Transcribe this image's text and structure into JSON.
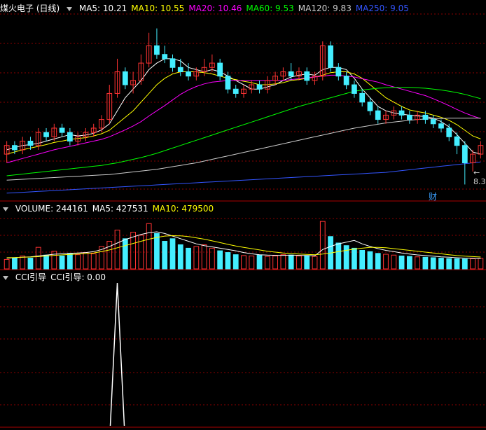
{
  "title": "煤火电子 (日线)",
  "price_legend": [
    {
      "label": "MA5: 10.21",
      "color": "#ffffff"
    },
    {
      "label": "MA10: 10.55",
      "color": "#ffff00"
    },
    {
      "label": "MA20: 10.46",
      "color": "#ff00ff"
    },
    {
      "label": "MA60: 9.53",
      "color": "#00ff00"
    },
    {
      "label": "MA120: 9.83",
      "color": "#cccccc"
    },
    {
      "label": "MA250: 9.05",
      "color": "#3355ff"
    }
  ],
  "low_price_label": "8.30",
  "finance_marker": "财",
  "volume_legend": [
    {
      "label": "VOLUME: 244161",
      "color": "#ffffff"
    },
    {
      "label": "MA5: 427531",
      "color": "#ffffff"
    },
    {
      "label": "MA10: 479500",
      "color": "#ffff00"
    }
  ],
  "cci_legend": [
    {
      "label": "CCI引导",
      "color": "#ffffff"
    },
    {
      "label": "CCI引导: 0.00",
      "color": "#ffffff"
    }
  ],
  "colors": {
    "up": "#ff3333",
    "down": "#44eeff",
    "grid": "#8b0000",
    "bg": "#000000"
  },
  "chart_data": [
    {
      "type": "candlestick",
      "title": "煤火电子 (日线)",
      "ylim": [
        8.0,
        12.2
      ],
      "candles": [
        [
          9.0,
          9.2,
          8.8,
          9.3
        ],
        [
          9.2,
          9.1,
          9.0,
          9.3
        ],
        [
          9.1,
          9.3,
          9.0,
          9.4
        ],
        [
          9.3,
          9.2,
          9.1,
          9.4
        ],
        [
          9.2,
          9.5,
          9.1,
          9.6
        ],
        [
          9.5,
          9.4,
          9.3,
          9.6
        ],
        [
          9.4,
          9.6,
          9.3,
          9.7
        ],
        [
          9.6,
          9.5,
          9.4,
          9.7
        ],
        [
          9.5,
          9.3,
          9.2,
          9.6
        ],
        [
          9.3,
          9.4,
          9.2,
          9.5
        ],
        [
          9.4,
          9.5,
          9.3,
          9.6
        ],
        [
          9.5,
          9.6,
          9.4,
          9.7
        ],
        [
          9.6,
          9.8,
          9.5,
          9.9
        ],
        [
          9.8,
          10.4,
          9.7,
          10.6
        ],
        [
          10.4,
          10.9,
          10.3,
          11.2
        ],
        [
          10.9,
          10.6,
          10.5,
          11.0
        ],
        [
          10.6,
          10.7,
          10.4,
          10.9
        ],
        [
          10.7,
          11.1,
          10.6,
          11.3
        ],
        [
          11.1,
          11.5,
          11.0,
          11.8
        ],
        [
          11.5,
          11.3,
          11.2,
          11.9
        ],
        [
          11.3,
          11.2,
          11.1,
          11.5
        ],
        [
          11.2,
          11.0,
          10.9,
          11.3
        ],
        [
          11.0,
          10.9,
          10.8,
          11.2
        ],
        [
          10.9,
          10.8,
          10.7,
          11.1
        ],
        [
          10.8,
          10.9,
          10.7,
          11.0
        ],
        [
          10.9,
          11.0,
          10.8,
          11.2
        ],
        [
          11.0,
          11.1,
          10.9,
          11.3
        ],
        [
          11.1,
          10.8,
          10.7,
          11.2
        ],
        [
          10.8,
          10.5,
          10.4,
          10.9
        ],
        [
          10.5,
          10.4,
          10.3,
          10.6
        ],
        [
          10.4,
          10.5,
          10.3,
          10.6
        ],
        [
          10.5,
          10.6,
          10.4,
          10.7
        ],
        [
          10.6,
          10.5,
          10.4,
          10.7
        ],
        [
          10.5,
          10.7,
          10.4,
          10.8
        ],
        [
          10.7,
          10.8,
          10.6,
          10.9
        ],
        [
          10.8,
          10.9,
          10.7,
          11.0
        ],
        [
          10.9,
          10.8,
          10.7,
          11.1
        ],
        [
          10.8,
          10.9,
          10.7,
          11.0
        ],
        [
          10.9,
          10.7,
          10.6,
          11.0
        ],
        [
          10.7,
          10.8,
          10.6,
          10.9
        ],
        [
          10.8,
          11.5,
          10.7,
          11.6
        ],
        [
          11.5,
          11.0,
          10.9,
          11.6
        ],
        [
          11.0,
          10.8,
          10.7,
          11.1
        ],
        [
          10.8,
          10.6,
          10.5,
          10.9
        ],
        [
          10.6,
          10.4,
          10.3,
          10.7
        ],
        [
          10.4,
          10.2,
          10.1,
          10.5
        ],
        [
          10.2,
          10.0,
          9.9,
          10.3
        ],
        [
          10.0,
          9.8,
          9.7,
          10.1
        ],
        [
          9.8,
          9.9,
          9.7,
          10.0
        ],
        [
          9.9,
          10.0,
          9.8,
          10.1
        ],
        [
          10.0,
          9.9,
          9.8,
          10.1
        ],
        [
          9.9,
          9.8,
          9.7,
          10.0
        ],
        [
          9.8,
          9.9,
          9.7,
          10.0
        ],
        [
          9.9,
          9.8,
          9.7,
          10.0
        ],
        [
          9.8,
          9.7,
          9.6,
          9.9
        ],
        [
          9.7,
          9.6,
          9.5,
          9.8
        ],
        [
          9.6,
          9.4,
          9.3,
          9.7
        ],
        [
          9.4,
          9.2,
          9.0,
          9.5
        ],
        [
          9.2,
          8.8,
          8.3,
          9.3
        ],
        [
          8.8,
          9.0,
          8.6,
          9.1
        ],
        [
          9.0,
          9.2,
          8.9,
          9.3
        ]
      ],
      "series_ma": [
        {
          "name": "MA5",
          "color": "#ffffff",
          "values": [
            9.1,
            9.15,
            9.2,
            9.22,
            9.25,
            9.3,
            9.35,
            9.4,
            9.45,
            9.42,
            9.44,
            9.48,
            9.56,
            9.7,
            10.0,
            10.3,
            10.5,
            10.7,
            10.95,
            11.1,
            11.2,
            11.2,
            11.15,
            11.0,
            10.95,
            10.9,
            10.95,
            10.9,
            10.8,
            10.7,
            10.6,
            10.5,
            10.5,
            10.55,
            10.6,
            10.7,
            10.78,
            10.82,
            10.85,
            10.82,
            10.95,
            11.0,
            11.0,
            10.95,
            10.75,
            10.5,
            10.3,
            10.1,
            10.0,
            9.95,
            9.92,
            9.9,
            9.88,
            9.87,
            9.83,
            9.75,
            9.63,
            9.45,
            9.25,
            9.05,
            9.0
          ]
        },
        {
          "name": "MA10",
          "color": "#ffff00",
          "values": [
            9.0,
            9.05,
            9.1,
            9.14,
            9.18,
            9.22,
            9.27,
            9.3,
            9.34,
            9.36,
            9.38,
            9.42,
            9.47,
            9.55,
            9.7,
            9.85,
            10.0,
            10.2,
            10.4,
            10.6,
            10.75,
            10.85,
            10.9,
            10.9,
            10.9,
            10.88,
            10.85,
            10.8,
            10.75,
            10.72,
            10.68,
            10.65,
            10.6,
            10.6,
            10.62,
            10.65,
            10.7,
            10.72,
            10.75,
            10.78,
            10.82,
            10.88,
            10.9,
            10.9,
            10.85,
            10.75,
            10.6,
            10.45,
            10.3,
            10.2,
            10.1,
            10.02,
            9.98,
            9.95,
            9.9,
            9.85,
            9.78,
            9.68,
            9.55,
            9.42,
            9.35
          ]
        },
        {
          "name": "MA20",
          "color": "#ff00ff",
          "values": [
            8.8,
            8.85,
            8.9,
            8.95,
            9.0,
            9.05,
            9.1,
            9.14,
            9.18,
            9.22,
            9.26,
            9.3,
            9.34,
            9.4,
            9.48,
            9.56,
            9.65,
            9.75,
            9.88,
            10.0,
            10.12,
            10.25,
            10.38,
            10.48,
            10.56,
            10.62,
            10.66,
            10.68,
            10.7,
            10.7,
            10.7,
            10.7,
            10.7,
            10.7,
            10.7,
            10.7,
            10.72,
            10.74,
            10.76,
            10.78,
            10.8,
            10.82,
            10.82,
            10.8,
            10.78,
            10.74,
            10.7,
            10.66,
            10.6,
            10.55,
            10.5,
            10.45,
            10.4,
            10.35,
            10.28,
            10.2,
            10.12,
            10.03,
            9.95,
            9.88,
            9.82
          ]
        },
        {
          "name": "MA60",
          "color": "#00ff00",
          "values": [
            8.5,
            8.52,
            8.54,
            8.56,
            8.58,
            8.6,
            8.62,
            8.64,
            8.66,
            8.68,
            8.7,
            8.72,
            8.74,
            8.77,
            8.8,
            8.84,
            8.88,
            8.92,
            8.97,
            9.02,
            9.08,
            9.14,
            9.2,
            9.26,
            9.32,
            9.38,
            9.44,
            9.5,
            9.56,
            9.62,
            9.68,
            9.74,
            9.8,
            9.86,
            9.92,
            9.98,
            10.04,
            10.1,
            10.15,
            10.2,
            10.25,
            10.3,
            10.35,
            10.4,
            10.45,
            10.48,
            10.5,
            10.52,
            10.53,
            10.54,
            10.54,
            10.54,
            10.53,
            10.52,
            10.5,
            10.48,
            10.45,
            10.42,
            10.38,
            10.33,
            10.28
          ]
        },
        {
          "name": "MA120",
          "color": "#cccccc",
          "values": [
            8.4,
            8.41,
            8.42,
            8.43,
            8.44,
            8.45,
            8.46,
            8.47,
            8.48,
            8.49,
            8.5,
            8.51,
            8.52,
            8.53,
            8.55,
            8.57,
            8.59,
            8.61,
            8.63,
            8.65,
            8.68,
            8.71,
            8.74,
            8.77,
            8.8,
            8.84,
            8.88,
            8.92,
            8.96,
            9.0,
            9.04,
            9.08,
            9.12,
            9.16,
            9.2,
            9.24,
            9.28,
            9.32,
            9.36,
            9.4,
            9.44,
            9.48,
            9.52,
            9.56,
            9.6,
            9.63,
            9.66,
            9.69,
            9.72,
            9.74,
            9.76,
            9.78,
            9.8,
            9.81,
            9.82,
            9.82,
            9.83,
            9.83,
            9.83,
            9.83,
            9.83
          ]
        },
        {
          "name": "MA250",
          "color": "#3355ff",
          "values": [
            8.1,
            8.11,
            8.12,
            8.13,
            8.14,
            8.15,
            8.16,
            8.17,
            8.18,
            8.19,
            8.2,
            8.21,
            8.22,
            8.23,
            8.24,
            8.25,
            8.26,
            8.27,
            8.28,
            8.29,
            8.3,
            8.31,
            8.32,
            8.33,
            8.34,
            8.35,
            8.36,
            8.37,
            8.38,
            8.39,
            8.4,
            8.41,
            8.42,
            8.43,
            8.44,
            8.45,
            8.46,
            8.47,
            8.48,
            8.49,
            8.5,
            8.51,
            8.52,
            8.53,
            8.54,
            8.55,
            8.56,
            8.57,
            8.58,
            8.6,
            8.62,
            8.64,
            8.66,
            8.68,
            8.7,
            8.72,
            8.74,
            8.76,
            8.78,
            8.8,
            8.82
          ]
        }
      ]
    },
    {
      "type": "bar",
      "title": "VOLUME",
      "ylim": [
        0,
        1200000
      ],
      "values": [
        220000,
        260000,
        300000,
        250000,
        500000,
        320000,
        410000,
        300000,
        360000,
        330000,
        380000,
        350000,
        520000,
        640000,
        900000,
        700000,
        850000,
        780000,
        1050000,
        820000,
        640000,
        700000,
        560000,
        480000,
        520000,
        560000,
        480000,
        420000,
        380000,
        330000,
        310000,
        300000,
        320000,
        290000,
        300000,
        330000,
        320000,
        300000,
        310000,
        290000,
        1100000,
        750000,
        600000,
        540000,
        480000,
        430000,
        400000,
        360000,
        340000,
        320000,
        300000,
        290000,
        280000,
        270000,
        260000,
        250000,
        240000,
        235000,
        230000,
        235000,
        244161
      ],
      "up": [
        1,
        0,
        1,
        0,
        1,
        0,
        1,
        0,
        0,
        1,
        1,
        1,
        1,
        1,
        1,
        0,
        1,
        1,
        1,
        0,
        0,
        0,
        0,
        0,
        1,
        1,
        1,
        0,
        0,
        0,
        1,
        1,
        0,
        1,
        1,
        1,
        0,
        1,
        0,
        1,
        1,
        0,
        0,
        0,
        0,
        0,
        0,
        0,
        1,
        1,
        0,
        0,
        1,
        0,
        0,
        0,
        0,
        0,
        0,
        1,
        1
      ],
      "ma5": [
        250000,
        260000,
        270000,
        280000,
        300000,
        320000,
        340000,
        350000,
        360000,
        370000,
        380000,
        400000,
        450000,
        520000,
        600000,
        680000,
        740000,
        800000,
        840000,
        860000,
        820000,
        760000,
        700000,
        640000,
        580000,
        540000,
        510000,
        480000,
        450000,
        420000,
        380000,
        350000,
        330000,
        320000,
        315000,
        315000,
        320000,
        315000,
        310000,
        305000,
        450000,
        520000,
        580000,
        620000,
        660000,
        580000,
        520000,
        470000,
        430000,
        400000,
        370000,
        345000,
        325000,
        310000,
        295000,
        280000,
        270000,
        260000,
        250000,
        245000,
        240000
      ],
      "ma10": [
        260000,
        265000,
        270000,
        275000,
        285000,
        300000,
        315000,
        325000,
        335000,
        345000,
        355000,
        370000,
        400000,
        440000,
        490000,
        540000,
        590000,
        640000,
        690000,
        730000,
        760000,
        770000,
        765000,
        750000,
        720000,
        690000,
        650000,
        610000,
        570000,
        530000,
        500000,
        470000,
        440000,
        410000,
        390000,
        370000,
        355000,
        345000,
        335000,
        330000,
        345000,
        370000,
        400000,
        430000,
        460000,
        480000,
        500000,
        500000,
        490000,
        470000,
        450000,
        430000,
        410000,
        390000,
        370000,
        350000,
        330000,
        310000,
        295000,
        285000,
        275000
      ]
    },
    {
      "type": "line",
      "title": "CCI引导",
      "ylim": [
        0,
        100
      ],
      "values": [
        0,
        0,
        0,
        0,
        0,
        0,
        0,
        0,
        0,
        0,
        0,
        0,
        0,
        0,
        100,
        0,
        0,
        0,
        0,
        0,
        0,
        0,
        0,
        0,
        0,
        0,
        0,
        0,
        0,
        0,
        0,
        0,
        0,
        0,
        0,
        0,
        0,
        0,
        0,
        0,
        0,
        0,
        0,
        0,
        0,
        0,
        0,
        0,
        0,
        0,
        0,
        0,
        0,
        0,
        0,
        0,
        0,
        0,
        0,
        0,
        0
      ]
    }
  ]
}
